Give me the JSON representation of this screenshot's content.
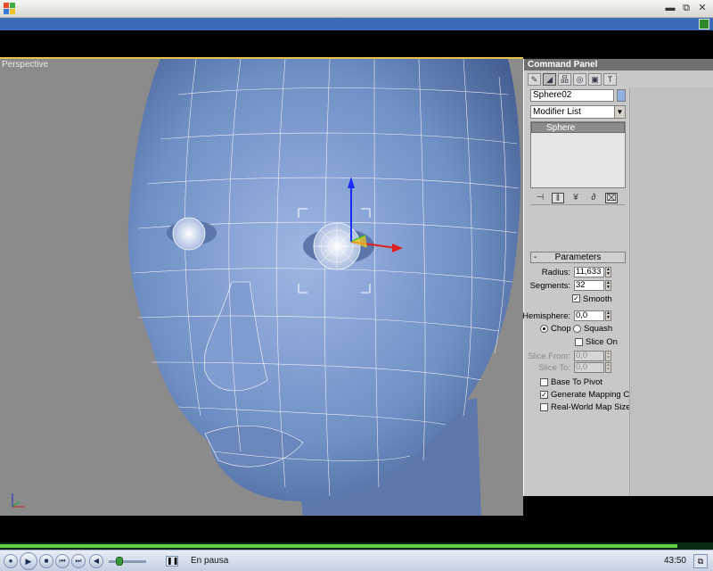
{
  "window": {
    "minimize_glyph": "▬",
    "restore_glyph": "⧉",
    "close_glyph": "✕"
  },
  "viewport": {
    "label": "Perspective",
    "colors": {
      "background": "#8b8b8b",
      "mesh": "#6f8fc6",
      "wire": "#ffffff",
      "active_border": "#e6c24a"
    }
  },
  "command_panel": {
    "title": "Command Panel",
    "tabs": [
      {
        "icon": "create-icon",
        "glyph": "✎"
      },
      {
        "icon": "modify-icon",
        "glyph": "◢"
      },
      {
        "icon": "hierarchy-icon",
        "glyph": "品"
      },
      {
        "icon": "motion-icon",
        "glyph": "◎"
      },
      {
        "icon": "display-icon",
        "glyph": "▣"
      },
      {
        "icon": "utilities-icon",
        "glyph": "T"
      }
    ],
    "object_name": "Sphere02",
    "modifier_list": "Modifier List",
    "stack_items": [
      "Sphere"
    ],
    "stack_tools": [
      "⊣",
      "‖",
      "¥",
      "∂",
      "⌧"
    ],
    "parameters": {
      "header": "Parameters",
      "collapse_glyph": "-",
      "radius_label": "Radius:",
      "radius": "11,633",
      "segments_label": "Segments:",
      "segments": "32",
      "smooth_label": "Smooth",
      "smooth": true,
      "hemisphere_label": "Hemisphere:",
      "hemisphere": "0,0",
      "chop_label": "Chop",
      "squash_label": "Squash",
      "slice_on_label": "Slice On",
      "slice_from_label": "Slice From:",
      "slice_from": "0,0",
      "slice_to_label": "Slice To:",
      "slice_to": "0,0",
      "base_to_pivot_label": "Base To Pivot",
      "gen_mapping_label": "Generate Mapping Coords.",
      "real_world_label": "Real-World Map Size"
    }
  },
  "player": {
    "status": "En pausa",
    "time": "43:50",
    "progress": 0.95,
    "volume": 0.2
  }
}
